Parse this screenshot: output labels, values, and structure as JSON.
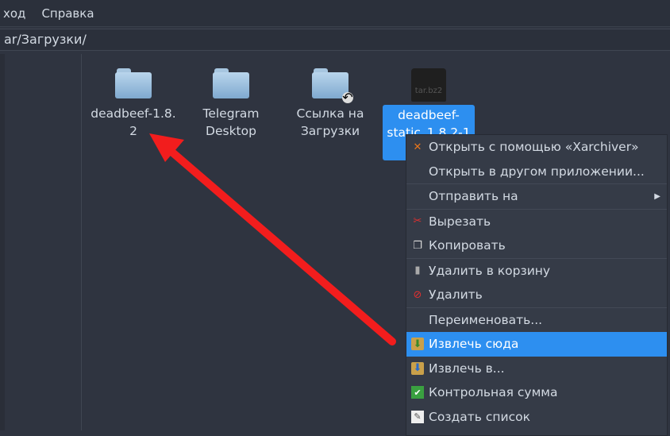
{
  "menubar": {
    "items": [
      "ход",
      "Справка"
    ]
  },
  "path": "ar/Загрузки/",
  "files": [
    {
      "name": "deadbeef-1.8.\n2",
      "type": "folder"
    },
    {
      "name": "Telegram\nDesktop",
      "type": "folder"
    },
    {
      "name": "Ссылка на\nЗагрузки",
      "type": "folder-link"
    },
    {
      "name": "deadbeef-\nstatic_1.8.2-1\nx86",
      "type": "archive",
      "icon_label": "tar.bz2",
      "selected": true
    }
  ],
  "context_menu": {
    "items": [
      {
        "label": "Открыть с помощью «Xarchiver»",
        "icon": "xarchiver-icon"
      },
      {
        "label": "Открыть в другом приложении...",
        "icon": ""
      },
      {
        "label": "Отправить на",
        "icon": "",
        "submenu": true
      },
      {
        "label": "Вырезать",
        "icon": "scissors-icon"
      },
      {
        "label": "Копировать",
        "icon": "copy-icon"
      },
      {
        "label": "Удалить в корзину",
        "icon": "trash-icon"
      },
      {
        "label": "Удалить",
        "icon": "delete-icon"
      },
      {
        "label": "Переименовать...",
        "icon": ""
      },
      {
        "label": "Извлечь сюда",
        "icon": "extract-here-icon",
        "highlighted": true
      },
      {
        "label": "Извлечь в...",
        "icon": "extract-to-icon"
      },
      {
        "label": "Контрольная сумма",
        "icon": "checksum-icon"
      },
      {
        "label": "Создать список",
        "icon": "create-list-icon"
      }
    ]
  },
  "colors": {
    "accent": "#2d8ff0",
    "arrow": "#f21d1d"
  }
}
